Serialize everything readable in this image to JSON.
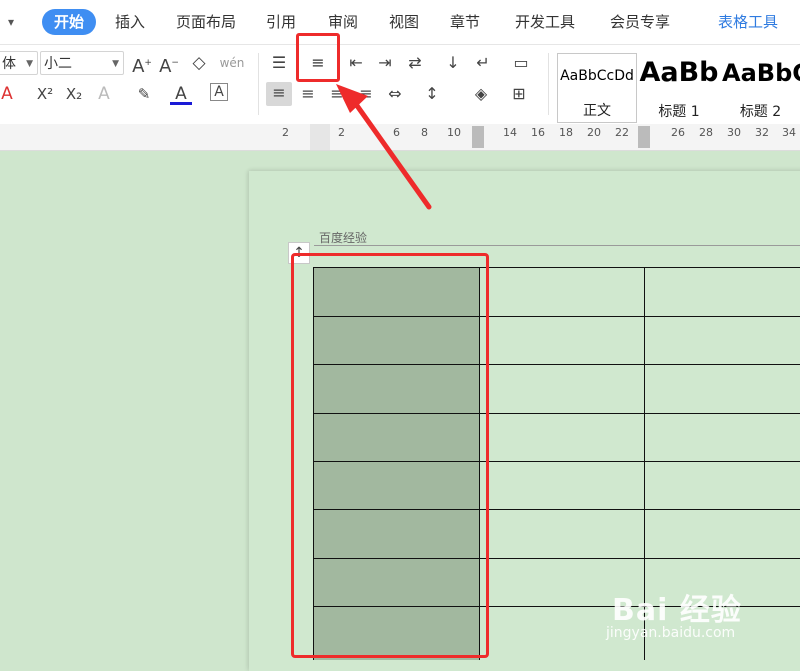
{
  "menu": {
    "items": [
      "开始",
      "插入",
      "页面布局",
      "引用",
      "审阅",
      "视图",
      "章节",
      "开发工具",
      "会员专享"
    ],
    "contextual_tab": "表格工具",
    "collapse_icon": "chevron-down-icon"
  },
  "toolbar": {
    "font_name": "体",
    "font_size": "小二",
    "phonetic_label": "wén",
    "styles": [
      {
        "sample": "AaBbCcDd",
        "label": "正文"
      },
      {
        "sample": "AaBb",
        "label": "标题 1"
      },
      {
        "sample": "AaBbC",
        "label": "标题 2"
      }
    ]
  },
  "ruler": {
    "ticks": [
      "2",
      "2",
      "6",
      "8",
      "10",
      "14",
      "16",
      "18",
      "20",
      "22",
      "26",
      "28",
      "30",
      "32",
      "34"
    ]
  },
  "document": {
    "header_text": "百度经验"
  },
  "watermark": {
    "logo": "Bai 经验",
    "url": "jingyan.baidu.com"
  },
  "colors": {
    "accent": "#3f8ef2",
    "annotation": "#ee2b2b",
    "page_bg": "#d0e8cf",
    "selected_cell": "#a2b89f"
  }
}
